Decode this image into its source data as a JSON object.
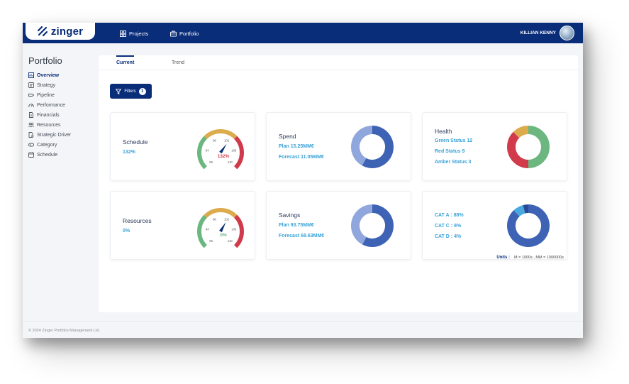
{
  "app": {
    "logo_text": "zinger",
    "nav": [
      {
        "label": "Projects",
        "icon": "grid-icon"
      },
      {
        "label": "Portfolio",
        "icon": "briefcase-icon"
      }
    ],
    "user_name": "KILLIAN KENNY"
  },
  "sidebar": {
    "title": "Portfolio",
    "items": [
      {
        "label": "Overview",
        "active": true
      },
      {
        "label": "Strategy"
      },
      {
        "label": "Pipeline"
      },
      {
        "label": "Performance"
      },
      {
        "label": "Financials"
      },
      {
        "label": "Resources"
      },
      {
        "label": "Strategic Driver"
      },
      {
        "label": "Category"
      },
      {
        "label": "Schedule"
      }
    ]
  },
  "tabs": [
    {
      "label": "Current",
      "active": true
    },
    {
      "label": "Trend"
    }
  ],
  "filters": {
    "label": "Filters",
    "count": "1"
  },
  "cards": {
    "schedule": {
      "title": "Schedule",
      "value": "132%",
      "gauge": {
        "ticks": [
          "90",
          "94",
          "98",
          "102",
          "106",
          "110"
        ],
        "reading": "132%",
        "value_pct": 132
      }
    },
    "spend": {
      "title": "Spend",
      "plan": "Plan 15.25MM€",
      "forecast": "Forecast 11.05MM€",
      "donut": [
        {
          "label": "Plan",
          "value": 15.25,
          "color": "#3e63b4"
        },
        {
          "label": "Forecast",
          "value": 11.05,
          "color": "#8fa7dc"
        }
      ]
    },
    "health": {
      "title": "Health",
      "green": "Green Status 12",
      "red": "Red Status 9",
      "amber": "Amber Status 3",
      "donut": [
        {
          "label": "Green",
          "value": 12,
          "color": "#6cb67f"
        },
        {
          "label": "Red",
          "value": 9,
          "color": "#d13a4a"
        },
        {
          "label": "Amber",
          "value": 3,
          "color": "#dcab4c"
        }
      ]
    },
    "resources": {
      "title": "Resources",
      "value": "0%",
      "gauge": {
        "ticks": [
          "90",
          "94",
          "98",
          "102",
          "106",
          "110"
        ],
        "reading": "0%",
        "value_pct": 0
      }
    },
    "savings": {
      "title": "Savings",
      "plan": "Plan 93.75MM€",
      "forecast": "Forecast 68.63MM€",
      "donut": [
        {
          "label": "Plan",
          "value": 93.75,
          "color": "#3e63b4"
        },
        {
          "label": "Forecast",
          "value": 68.63,
          "color": "#8fa7dc"
        }
      ]
    },
    "category": {
      "cat_a": "CAT A : 88%",
      "cat_c": "CAT C : 8%",
      "cat_d": "CAT D : 4%",
      "donut": [
        {
          "label": "CAT A",
          "value": 88,
          "color": "#3e63b4"
        },
        {
          "label": "CAT C",
          "value": 8,
          "color": "#4aa8e0"
        },
        {
          "label": "CAT D",
          "value": 4,
          "color": "#274a94"
        }
      ]
    }
  },
  "units": {
    "label": "Units :",
    "text": "M = 1000s ,  MM = 1000000s"
  },
  "footer": "© 2024 Zinger Portfolio Management Ltd.",
  "colors": {
    "brand": "#0a2d7a",
    "accent_text": "#39a3d8",
    "gauge_green": "#6cb67f",
    "gauge_amber": "#dcab4c",
    "gauge_red": "#d13a4a"
  }
}
